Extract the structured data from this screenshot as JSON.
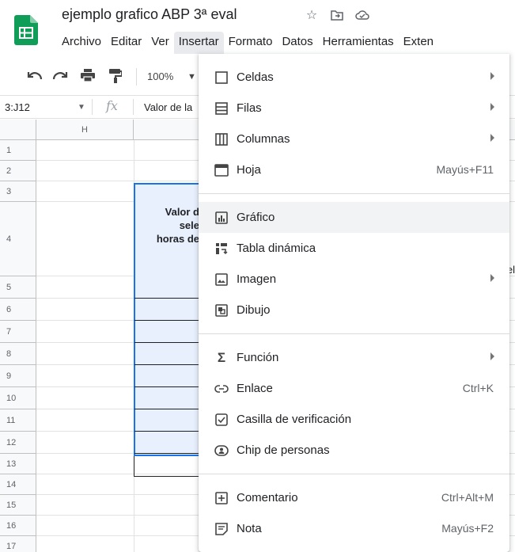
{
  "doc": {
    "title": "ejemplo grafico  ABP 3ª eval"
  },
  "menubar": [
    "Archivo",
    "Editar",
    "Ver",
    "Insertar",
    "Formato",
    "Datos",
    "Herramientas",
    "Exten"
  ],
  "toolbar": {
    "zoom": "100%"
  },
  "formula": {
    "name_box": "3:J12",
    "fx": "fx",
    "text": "Valor de la"
  },
  "grid": {
    "column_h": "H",
    "rows": [
      "1",
      "2",
      "3",
      "4",
      "5",
      "6",
      "7",
      "8",
      "9",
      "10",
      "11",
      "12",
      "13",
      "14",
      "15",
      "16",
      "17"
    ],
    "cell_lines": [
      "Valor d",
      "sele",
      "horas de"
    ],
    "edge_char": "el"
  },
  "menu": {
    "groups": [
      [
        {
          "label": "Celdas",
          "icon": "cells-icon",
          "submenu": true,
          "shortcut": ""
        },
        {
          "label": "Filas",
          "icon": "rows-icon",
          "submenu": true,
          "shortcut": ""
        },
        {
          "label": "Columnas",
          "icon": "columns-icon",
          "submenu": true,
          "shortcut": ""
        },
        {
          "label": "Hoja",
          "icon": "sheet-icon",
          "submenu": false,
          "shortcut": "Mayús+F11"
        }
      ],
      [
        {
          "label": "Gráfico",
          "icon": "chart-icon",
          "submenu": false,
          "shortcut": "",
          "hover": true
        },
        {
          "label": "Tabla dinámica",
          "icon": "pivot-table-icon",
          "submenu": false,
          "shortcut": ""
        },
        {
          "label": "Imagen",
          "icon": "image-icon",
          "submenu": true,
          "shortcut": ""
        },
        {
          "label": "Dibujo",
          "icon": "drawing-icon",
          "submenu": false,
          "shortcut": ""
        }
      ],
      [
        {
          "label": "Función",
          "icon": "sigma-icon",
          "submenu": true,
          "shortcut": ""
        },
        {
          "label": "Enlace",
          "icon": "link-icon",
          "submenu": false,
          "shortcut": "Ctrl+K"
        },
        {
          "label": "Casilla de verificación",
          "icon": "checkbox-icon",
          "submenu": false,
          "shortcut": ""
        },
        {
          "label": "Chip de personas",
          "icon": "person-chip-icon",
          "submenu": false,
          "shortcut": ""
        }
      ],
      [
        {
          "label": "Comentario",
          "icon": "comment-icon",
          "submenu": false,
          "shortcut": "Ctrl+Alt+M"
        },
        {
          "label": "Nota",
          "icon": "note-icon",
          "submenu": false,
          "shortcut": "Mayús+F2"
        }
      ]
    ]
  }
}
